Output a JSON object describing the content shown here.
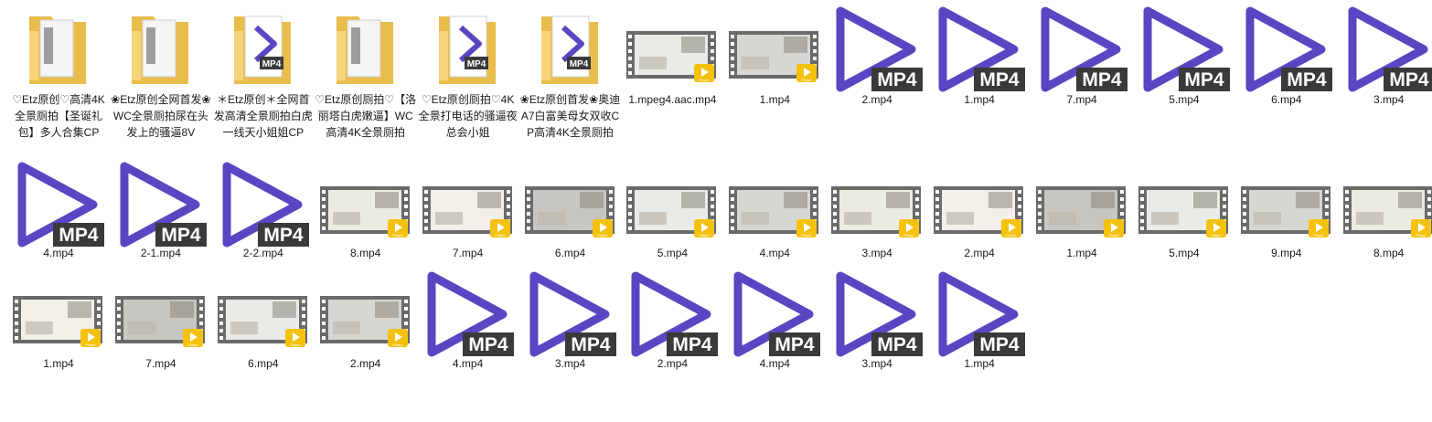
{
  "colors": {
    "folder": "#f6d57a",
    "folder_dark": "#e8bd4b",
    "mp4_purple": "#5b45c2",
    "mp4_badge": "#3a3a3a",
    "player_badge": "#f4c20d",
    "film": "#6a6a6a"
  },
  "rows": [
    [
      {
        "type": "folder",
        "label": "♡Etz原创♡高清4K全景厕拍【圣诞礼包】多人合集CP"
      },
      {
        "type": "folder",
        "label": "❀Etz原创全网首发❀WC全景厕拍尿在头发上的骚逼8V"
      },
      {
        "type": "folder",
        "overlay": "mp4",
        "label": "＊Etz原创＊全网首发高清全景厕拍白虎一线天小姐姐CP"
      },
      {
        "type": "folder",
        "label": "♡Etz原创厕拍♡【洛丽塔白虎嫩逼】WC高清4K全景厕拍"
      },
      {
        "type": "folder",
        "overlay": "mp4",
        "label": "♡Etz原创厕拍♡4K全景打电话的骚逼夜总会小姐"
      },
      {
        "type": "folder",
        "overlay": "mp4",
        "label": "❀Etz原创首发❀奥迪A7白富美母女双收CP高清4K全景厕拍"
      },
      {
        "type": "video",
        "label": "1.mpeg4.aac.mp4"
      },
      {
        "type": "video",
        "label": "1.mp4"
      },
      {
        "type": "mp4",
        "label": "2.mp4"
      },
      {
        "type": "mp4",
        "label": "1.mp4"
      },
      {
        "type": "mp4",
        "label": "7.mp4"
      },
      {
        "type": "mp4",
        "label": "5.mp4"
      },
      {
        "type": "mp4",
        "label": "6.mp4"
      },
      {
        "type": "mp4",
        "label": "3.mp4"
      }
    ],
    [
      {
        "type": "mp4",
        "label": "4.mp4"
      },
      {
        "type": "mp4",
        "label": "2-1.mp4"
      },
      {
        "type": "mp4",
        "label": "2-2.mp4"
      },
      {
        "type": "video",
        "label": "8.mp4"
      },
      {
        "type": "video",
        "label": "7.mp4"
      },
      {
        "type": "video",
        "label": "6.mp4"
      },
      {
        "type": "video",
        "label": "5.mp4"
      },
      {
        "type": "video",
        "label": "4.mp4"
      },
      {
        "type": "video",
        "label": "3.mp4"
      },
      {
        "type": "video",
        "label": "2.mp4"
      },
      {
        "type": "video",
        "label": "1.mp4"
      },
      {
        "type": "video",
        "label": "5.mp4"
      },
      {
        "type": "video",
        "label": "9.mp4"
      },
      {
        "type": "video",
        "label": "8.mp4"
      }
    ],
    [
      {
        "type": "video",
        "label": "1.mp4"
      },
      {
        "type": "video",
        "label": "7.mp4"
      },
      {
        "type": "video",
        "label": "6.mp4"
      },
      {
        "type": "video",
        "label": "2.mp4"
      },
      {
        "type": "mp4",
        "label": "4.mp4"
      },
      {
        "type": "mp4",
        "label": "3.mp4"
      },
      {
        "type": "mp4",
        "label": "2.mp4"
      },
      {
        "type": "mp4",
        "label": "4.mp4"
      },
      {
        "type": "mp4",
        "label": "3.mp4"
      },
      {
        "type": "mp4",
        "label": "1.mp4"
      }
    ]
  ],
  "icon_text": {
    "mp4_badge": "MP4",
    "player_badge": "Player"
  }
}
